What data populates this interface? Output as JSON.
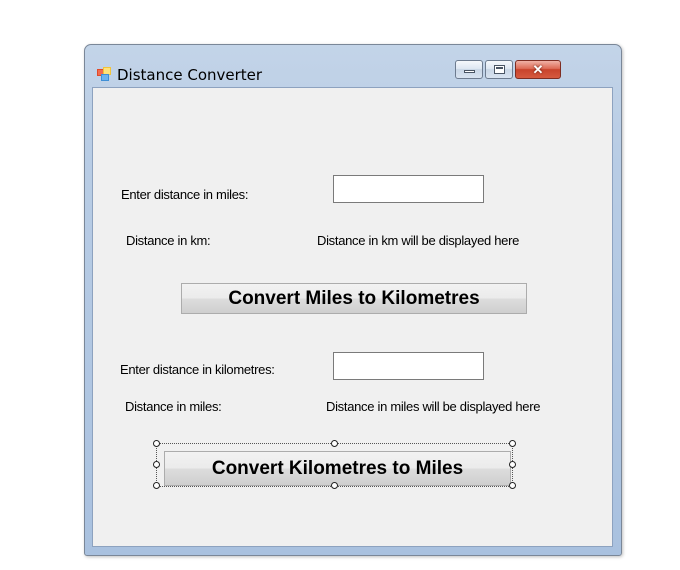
{
  "window": {
    "title": "Distance Converter",
    "icon": "app-window-icon"
  },
  "title_controls": {
    "minimize": "minimize-icon",
    "maximize": "maximize-icon",
    "close": "close-icon",
    "close_glyph": "✕"
  },
  "form": {
    "miles_label": "Enter distance in miles:",
    "miles_value": "",
    "km_result_label": "Distance in km:",
    "km_result_text": "Distance in km will be displayed here",
    "convert_m2k_button": "Convert Miles to Kilometres",
    "km_label": "Enter distance in kilometres:",
    "km_value": "",
    "miles_result_label": "Distance in miles:",
    "miles_result_text": "Distance in miles will be displayed here",
    "convert_k2m_button": "Convert Kilometres to Miles"
  },
  "colors": {
    "client_bg": "#f0f0f0",
    "close_button": "#c8432c",
    "frame": "#b9cde5"
  }
}
